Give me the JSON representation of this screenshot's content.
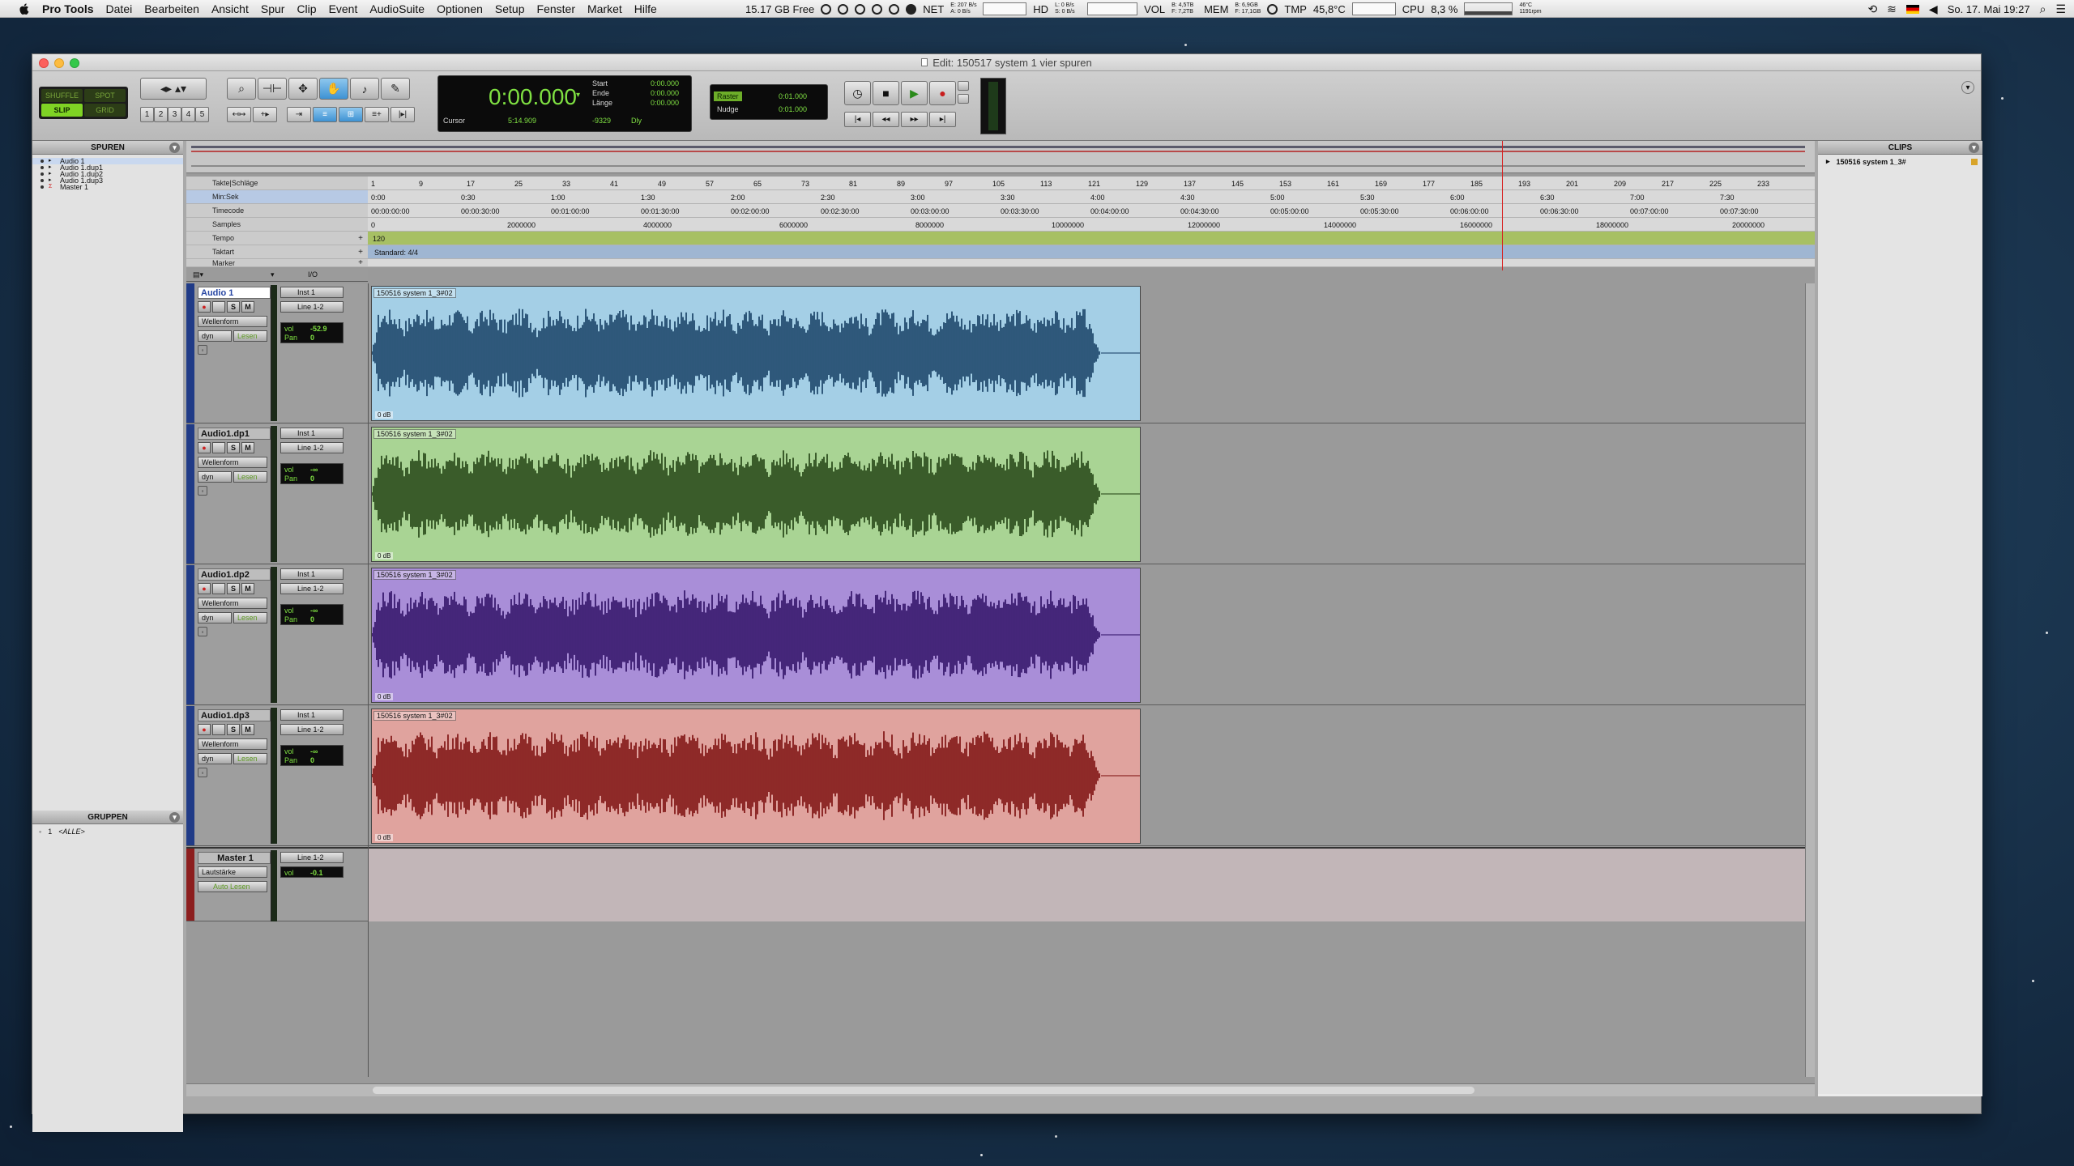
{
  "menubar": {
    "items": [
      "Pro Tools",
      "Datei",
      "Bearbeiten",
      "Ansicht",
      "Spur",
      "Clip",
      "Event",
      "AudioSuite",
      "Optionen",
      "Setup",
      "Fenster",
      "Market",
      "Hilfe"
    ],
    "free_space": "15.17 GB Free",
    "net_label": "NET",
    "net_stats": "E: 207 B/s\nA: 0 B/s",
    "hd_label": "HD",
    "hd_stats": "L: 0 B/s\nS: 0 B/s",
    "vol_label": "VOL",
    "vol_stats": "B: 4,5TB\nF: 7,2TB",
    "mem_label": "MEM",
    "mem_stats": "B: 6,9GB\nF: 17,1GB",
    "tmp_label": "TMP",
    "tmp_value": "45,8°C",
    "cpu_label": "CPU",
    "cpu_value": "8,3 %",
    "fan_stats": "46°C\n1191rpm",
    "datetime": "So. 17. Mai  19:27"
  },
  "window": {
    "title": "Edit: 150517 system 1 vier spuren"
  },
  "toolbar": {
    "modes": [
      "SHUFFLE",
      "SPOT",
      "SLIP",
      "GRID"
    ],
    "active_mode": "SLIP",
    "zoom_presets": [
      "1",
      "2",
      "3",
      "4",
      "5"
    ],
    "counter": {
      "main": "0:00.000",
      "cursor_label": "Cursor",
      "cursor_value": "5:14.909",
      "neg_value": "-9329",
      "dly_label": "Dly",
      "start_label": "Start",
      "start_value": "0:00.000",
      "end_label": "Ende",
      "end_value": "0:00.000",
      "length_label": "Länge",
      "length_value": "0:00.000"
    },
    "grid": {
      "raster_label": "Raster",
      "raster_value": "0:01.000",
      "nudge_label": "Nudge",
      "nudge_value": "0:01.000"
    }
  },
  "tracks_panel": {
    "title": "SPUREN",
    "items": [
      "Audio 1",
      "Audio 1.dup1",
      "Audio 1.dup2",
      "Audio 1.dup3",
      "Master 1"
    ]
  },
  "groups_panel": {
    "title": "GRUPPEN",
    "items": [
      {
        "id": "1",
        "name": "<ALLE>"
      }
    ]
  },
  "clips_panel": {
    "title": "CLIPS",
    "items": [
      "150516 system 1_3#"
    ]
  },
  "rulers": {
    "labels": [
      "Takte|Schläge",
      "Min:Sek",
      "Timecode",
      "Samples",
      "Tempo",
      "Taktart",
      "Marker"
    ],
    "bars": [
      "1",
      "9",
      "17",
      "25",
      "33",
      "41",
      "49",
      "57",
      "65",
      "73",
      "81",
      "89",
      "97",
      "105",
      "113",
      "121",
      "129",
      "137",
      "145",
      "153",
      "161",
      "169",
      "177",
      "185",
      "193",
      "201",
      "209",
      "217",
      "225",
      "233"
    ],
    "minsec": [
      "0:00",
      "0:30",
      "1:00",
      "1:30",
      "2:00",
      "2:30",
      "3:00",
      "3:30",
      "4:00",
      "4:30",
      "5:00",
      "5:30",
      "6:00",
      "6:30",
      "7:00",
      "7:30"
    ],
    "timecode": [
      "00:00:00:00",
      "00:00:30:00",
      "00:01:00:00",
      "00:01:30:00",
      "00:02:00:00",
      "00:02:30:00",
      "00:03:00:00",
      "00:03:30:00",
      "00:04:00:00",
      "00:04:30:00",
      "00:05:00:00",
      "00:05:30:00",
      "00:06:00:00",
      "00:06:30:00",
      "00:07:00:00",
      "00:07:30:00"
    ],
    "samples": [
      "0",
      "2000000",
      "4000000",
      "6000000",
      "8000000",
      "10000000",
      "12000000",
      "14000000",
      "16000000",
      "18000000",
      "20000000"
    ],
    "tempo_value": "120",
    "meter_value": "Standard: 4/4",
    "io_header": "I/O"
  },
  "tracks": [
    {
      "name": "Audio 1",
      "selected": true,
      "input": "Inst 1",
      "output": "Line 1-2",
      "view": "Wellenform",
      "dyn": "dyn",
      "auto": "Lesen",
      "vol": "-52.9",
      "pan": "0",
      "clip_name": "150516 system 1_3#02",
      "gain": "0 dB",
      "color": "#a4cfe6",
      "wave": "#123a60"
    },
    {
      "name": "Audio1.dp1",
      "selected": false,
      "input": "Inst 1",
      "output": "Line 1-2",
      "view": "Wellenform",
      "dyn": "dyn",
      "auto": "Lesen",
      "vol": "-∞",
      "pan": "0",
      "clip_name": "150516 system 1_3#02",
      "gain": "0 dB",
      "color": "#a9d494",
      "wave": "#1e3e10"
    },
    {
      "name": "Audio1.dp2",
      "selected": false,
      "input": "Inst 1",
      "output": "Line 1-2",
      "view": "Wellenform",
      "dyn": "dyn",
      "auto": "Lesen",
      "vol": "-∞",
      "pan": "0",
      "clip_name": "150516 system 1_3#02",
      "gain": "0 dB",
      "color": "#a98ed8",
      "wave": "#2c0c62"
    },
    {
      "name": "Audio1.dp3",
      "selected": false,
      "input": "Inst 1",
      "output": "Line 1-2",
      "view": "Wellenform",
      "dyn": "dyn",
      "auto": "Lesen",
      "vol": "-∞",
      "pan": "0",
      "clip_name": "150516 system 1_3#02",
      "gain": "0 dB",
      "color": "#e0a39e",
      "wave": "#7a0b0b"
    }
  ],
  "master": {
    "name": "Master 1",
    "output": "Line 1-2",
    "view": "Lautstärke",
    "auto": "Auto Lesen",
    "vol": "-0.1"
  }
}
